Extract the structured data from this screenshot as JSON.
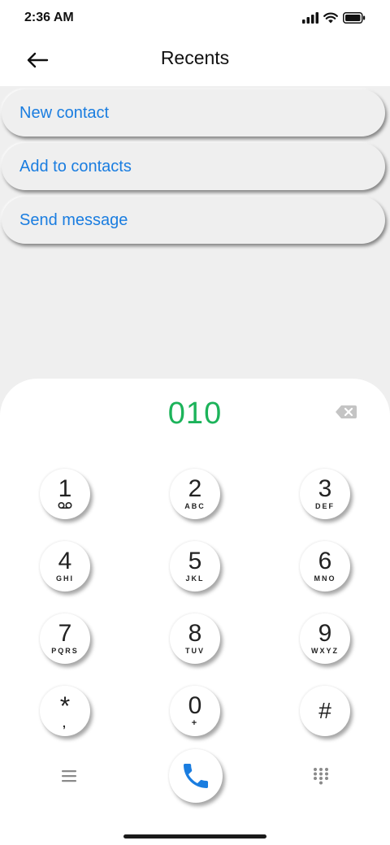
{
  "status": {
    "time": "2:36 AM"
  },
  "header": {
    "title": "Recents"
  },
  "actions": [
    {
      "label": "New contact"
    },
    {
      "label": "Add to contacts"
    },
    {
      "label": "Send message"
    }
  ],
  "dialer": {
    "number": "010",
    "keys": [
      {
        "digit": "1",
        "sub": ""
      },
      {
        "digit": "2",
        "sub": "ABC"
      },
      {
        "digit": "3",
        "sub": "DEF"
      },
      {
        "digit": "4",
        "sub": "GHI"
      },
      {
        "digit": "5",
        "sub": "JKL"
      },
      {
        "digit": "6",
        "sub": "MNO"
      },
      {
        "digit": "7",
        "sub": "PQRS"
      },
      {
        "digit": "8",
        "sub": "TUV"
      },
      {
        "digit": "9",
        "sub": "WXYZ"
      },
      {
        "digit": "*",
        "sub": ","
      },
      {
        "digit": "0",
        "sub": "+"
      },
      {
        "digit": "#",
        "sub": ""
      }
    ]
  },
  "colors": {
    "accent": "#1a7de0",
    "number": "#1cb35a",
    "call": "#1a7de0"
  },
  "icons": {
    "back": "arrow-left-icon",
    "backspace": "backspace-icon",
    "voicemail": "voicemail-icon",
    "menu": "menu-icon",
    "call": "phone-icon",
    "keypad": "keypad-icon"
  }
}
